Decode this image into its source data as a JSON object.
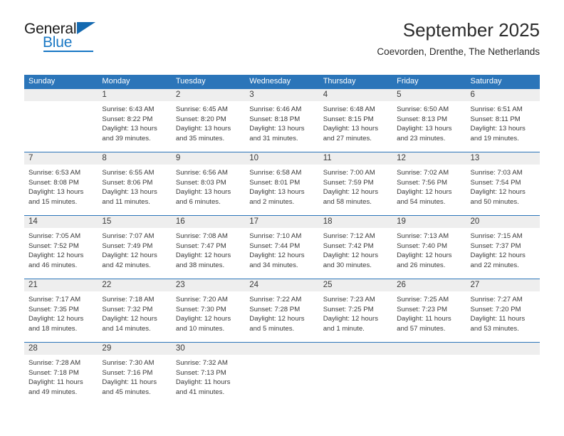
{
  "logo": {
    "text_primary": "General",
    "text_secondary": "Blue",
    "icon": "triangle-icon",
    "accent_color": "#1877c4"
  },
  "header": {
    "title": "September 2025",
    "subtitle": "Coevorden, Drenthe, The Netherlands"
  },
  "theme": {
    "header_row_bg": "#2b75b9",
    "daynum_bg": "#eeeeee",
    "text": "#3a3a3a"
  },
  "calendar": {
    "day_headers": [
      "Sunday",
      "Monday",
      "Tuesday",
      "Wednesday",
      "Thursday",
      "Friday",
      "Saturday"
    ],
    "weeks": [
      [
        {
          "day": "",
          "blank": true,
          "sunrise": "",
          "sunset": "",
          "daylight_1": "",
          "daylight_2": ""
        },
        {
          "day": "1",
          "sunrise": "Sunrise: 6:43 AM",
          "sunset": "Sunset: 8:22 PM",
          "daylight_1": "Daylight: 13 hours",
          "daylight_2": "and 39 minutes."
        },
        {
          "day": "2",
          "sunrise": "Sunrise: 6:45 AM",
          "sunset": "Sunset: 8:20 PM",
          "daylight_1": "Daylight: 13 hours",
          "daylight_2": "and 35 minutes."
        },
        {
          "day": "3",
          "sunrise": "Sunrise: 6:46 AM",
          "sunset": "Sunset: 8:18 PM",
          "daylight_1": "Daylight: 13 hours",
          "daylight_2": "and 31 minutes."
        },
        {
          "day": "4",
          "sunrise": "Sunrise: 6:48 AM",
          "sunset": "Sunset: 8:15 PM",
          "daylight_1": "Daylight: 13 hours",
          "daylight_2": "and 27 minutes."
        },
        {
          "day": "5",
          "sunrise": "Sunrise: 6:50 AM",
          "sunset": "Sunset: 8:13 PM",
          "daylight_1": "Daylight: 13 hours",
          "daylight_2": "and 23 minutes."
        },
        {
          "day": "6",
          "sunrise": "Sunrise: 6:51 AM",
          "sunset": "Sunset: 8:11 PM",
          "daylight_1": "Daylight: 13 hours",
          "daylight_2": "and 19 minutes."
        }
      ],
      [
        {
          "day": "7",
          "sunrise": "Sunrise: 6:53 AM",
          "sunset": "Sunset: 8:08 PM",
          "daylight_1": "Daylight: 13 hours",
          "daylight_2": "and 15 minutes."
        },
        {
          "day": "8",
          "sunrise": "Sunrise: 6:55 AM",
          "sunset": "Sunset: 8:06 PM",
          "daylight_1": "Daylight: 13 hours",
          "daylight_2": "and 11 minutes."
        },
        {
          "day": "9",
          "sunrise": "Sunrise: 6:56 AM",
          "sunset": "Sunset: 8:03 PM",
          "daylight_1": "Daylight: 13 hours",
          "daylight_2": "and 6 minutes."
        },
        {
          "day": "10",
          "sunrise": "Sunrise: 6:58 AM",
          "sunset": "Sunset: 8:01 PM",
          "daylight_1": "Daylight: 13 hours",
          "daylight_2": "and 2 minutes."
        },
        {
          "day": "11",
          "sunrise": "Sunrise: 7:00 AM",
          "sunset": "Sunset: 7:59 PM",
          "daylight_1": "Daylight: 12 hours",
          "daylight_2": "and 58 minutes."
        },
        {
          "day": "12",
          "sunrise": "Sunrise: 7:02 AM",
          "sunset": "Sunset: 7:56 PM",
          "daylight_1": "Daylight: 12 hours",
          "daylight_2": "and 54 minutes."
        },
        {
          "day": "13",
          "sunrise": "Sunrise: 7:03 AM",
          "sunset": "Sunset: 7:54 PM",
          "daylight_1": "Daylight: 12 hours",
          "daylight_2": "and 50 minutes."
        }
      ],
      [
        {
          "day": "14",
          "sunrise": "Sunrise: 7:05 AM",
          "sunset": "Sunset: 7:52 PM",
          "daylight_1": "Daylight: 12 hours",
          "daylight_2": "and 46 minutes."
        },
        {
          "day": "15",
          "sunrise": "Sunrise: 7:07 AM",
          "sunset": "Sunset: 7:49 PM",
          "daylight_1": "Daylight: 12 hours",
          "daylight_2": "and 42 minutes."
        },
        {
          "day": "16",
          "sunrise": "Sunrise: 7:08 AM",
          "sunset": "Sunset: 7:47 PM",
          "daylight_1": "Daylight: 12 hours",
          "daylight_2": "and 38 minutes."
        },
        {
          "day": "17",
          "sunrise": "Sunrise: 7:10 AM",
          "sunset": "Sunset: 7:44 PM",
          "daylight_1": "Daylight: 12 hours",
          "daylight_2": "and 34 minutes."
        },
        {
          "day": "18",
          "sunrise": "Sunrise: 7:12 AM",
          "sunset": "Sunset: 7:42 PM",
          "daylight_1": "Daylight: 12 hours",
          "daylight_2": "and 30 minutes."
        },
        {
          "day": "19",
          "sunrise": "Sunrise: 7:13 AM",
          "sunset": "Sunset: 7:40 PM",
          "daylight_1": "Daylight: 12 hours",
          "daylight_2": "and 26 minutes."
        },
        {
          "day": "20",
          "sunrise": "Sunrise: 7:15 AM",
          "sunset": "Sunset: 7:37 PM",
          "daylight_1": "Daylight: 12 hours",
          "daylight_2": "and 22 minutes."
        }
      ],
      [
        {
          "day": "21",
          "sunrise": "Sunrise: 7:17 AM",
          "sunset": "Sunset: 7:35 PM",
          "daylight_1": "Daylight: 12 hours",
          "daylight_2": "and 18 minutes."
        },
        {
          "day": "22",
          "sunrise": "Sunrise: 7:18 AM",
          "sunset": "Sunset: 7:32 PM",
          "daylight_1": "Daylight: 12 hours",
          "daylight_2": "and 14 minutes."
        },
        {
          "day": "23",
          "sunrise": "Sunrise: 7:20 AM",
          "sunset": "Sunset: 7:30 PM",
          "daylight_1": "Daylight: 12 hours",
          "daylight_2": "and 10 minutes."
        },
        {
          "day": "24",
          "sunrise": "Sunrise: 7:22 AM",
          "sunset": "Sunset: 7:28 PM",
          "daylight_1": "Daylight: 12 hours",
          "daylight_2": "and 5 minutes."
        },
        {
          "day": "25",
          "sunrise": "Sunrise: 7:23 AM",
          "sunset": "Sunset: 7:25 PM",
          "daylight_1": "Daylight: 12 hours",
          "daylight_2": "and 1 minute."
        },
        {
          "day": "26",
          "sunrise": "Sunrise: 7:25 AM",
          "sunset": "Sunset: 7:23 PM",
          "daylight_1": "Daylight: 11 hours",
          "daylight_2": "and 57 minutes."
        },
        {
          "day": "27",
          "sunrise": "Sunrise: 7:27 AM",
          "sunset": "Sunset: 7:20 PM",
          "daylight_1": "Daylight: 11 hours",
          "daylight_2": "and 53 minutes."
        }
      ],
      [
        {
          "day": "28",
          "sunrise": "Sunrise: 7:28 AM",
          "sunset": "Sunset: 7:18 PM",
          "daylight_1": "Daylight: 11 hours",
          "daylight_2": "and 49 minutes."
        },
        {
          "day": "29",
          "sunrise": "Sunrise: 7:30 AM",
          "sunset": "Sunset: 7:16 PM",
          "daylight_1": "Daylight: 11 hours",
          "daylight_2": "and 45 minutes."
        },
        {
          "day": "30",
          "sunrise": "Sunrise: 7:32 AM",
          "sunset": "Sunset: 7:13 PM",
          "daylight_1": "Daylight: 11 hours",
          "daylight_2": "and 41 minutes."
        },
        {
          "day": "",
          "blank": true,
          "sunrise": "",
          "sunset": "",
          "daylight_1": "",
          "daylight_2": ""
        },
        {
          "day": "",
          "blank": true,
          "sunrise": "",
          "sunset": "",
          "daylight_1": "",
          "daylight_2": ""
        },
        {
          "day": "",
          "blank": true,
          "sunrise": "",
          "sunset": "",
          "daylight_1": "",
          "daylight_2": ""
        },
        {
          "day": "",
          "blank": true,
          "sunrise": "",
          "sunset": "",
          "daylight_1": "",
          "daylight_2": ""
        }
      ]
    ]
  }
}
